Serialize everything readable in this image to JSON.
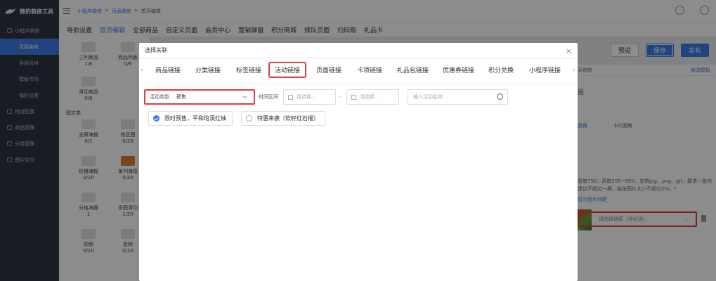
{
  "app": {
    "logo_text": "微豹装修工具"
  },
  "sidebar": {
    "items": [
      {
        "label": "小程序装修"
      },
      {
        "label": "页面装修"
      },
      {
        "label": "全店风格"
      },
      {
        "label": "模版市场"
      },
      {
        "label": "偏好设置"
      },
      {
        "label": "物流配置"
      },
      {
        "label": "商品管理"
      },
      {
        "label": "分类管理"
      },
      {
        "label": "图片空间"
      }
    ]
  },
  "breadcrumb": {
    "a": "小程序装修",
    "b": "页面装修",
    "c": "首页编辑",
    "sep": ">"
  },
  "navtabs": [
    "导航设置",
    "首页编辑",
    "全部商品",
    "自定义页面",
    "会员中心",
    "营销弹窗",
    "积分商城",
    "排队页面",
    "扫码购",
    "礼品卡"
  ],
  "widgets": {
    "cells": [
      {
        "label": "三列商品",
        "count": "1/6"
      },
      {
        "label": "商品列表",
        "count": "0/6"
      },
      {
        "label": "滑动商品",
        "count": "0/6"
      },
      {
        "label": "全屏海报",
        "count": "0/1"
      },
      {
        "label": "热区图",
        "count": "0/20"
      },
      {
        "label": "轮播海报",
        "count": "0/20"
      },
      {
        "label": "单列海报",
        "count": "5/20"
      },
      {
        "label": "分格海报",
        "count": "1"
      },
      {
        "label": "多图滑动",
        "count": "1/20"
      },
      {
        "label": "视频",
        "count": "0/10"
      },
      {
        "label": "音频",
        "count": "0/10"
      }
    ],
    "category": "图文类"
  },
  "actions": {
    "preview": "预览",
    "save": "保存",
    "publish": "发布"
  },
  "right_panel": {
    "head_left": "草稿箱",
    "head_right": "修改模板",
    "label1": "报",
    "style_label": "圆角",
    "style_value": "卡片圆角",
    "hint1": "宽度750，高度200~950，支持jpg、png、gif，要求一张内",
    "hint2": "建议不超过一屏，每张图片大小不超过2m。*",
    "hint3": "显示图片间距",
    "link_placeholder": "请选择链接（非必选）",
    "link_more": "..."
  },
  "dialog": {
    "title": "选择关联",
    "tabs": [
      "商品链接",
      "分类链接",
      "标签链接",
      "活动链接",
      "页面链接",
      "卡项链接",
      "礼品包链接",
      "优惠券链接",
      "积分兑换",
      "小程序链接"
    ],
    "active_tab": "活动链接",
    "filters": {
      "type_label": "活动类型",
      "type_value": "预售",
      "time_label": "时间区间",
      "date_start_placeholder": "请选择...",
      "date_end_placeholder": "请选择...",
      "date_sep": "-",
      "search_placeholder": "输入活动名称..."
    },
    "items": [
      {
        "label": "限时预售，平和琯溪红柚",
        "selected": true
      },
      {
        "label": "特惠来袭（软籽红石榴）",
        "selected": false
      }
    ]
  },
  "colors": {
    "accent": "#3d7be6",
    "highlight": "#e23c3c",
    "sidebar": "#2f3440"
  }
}
